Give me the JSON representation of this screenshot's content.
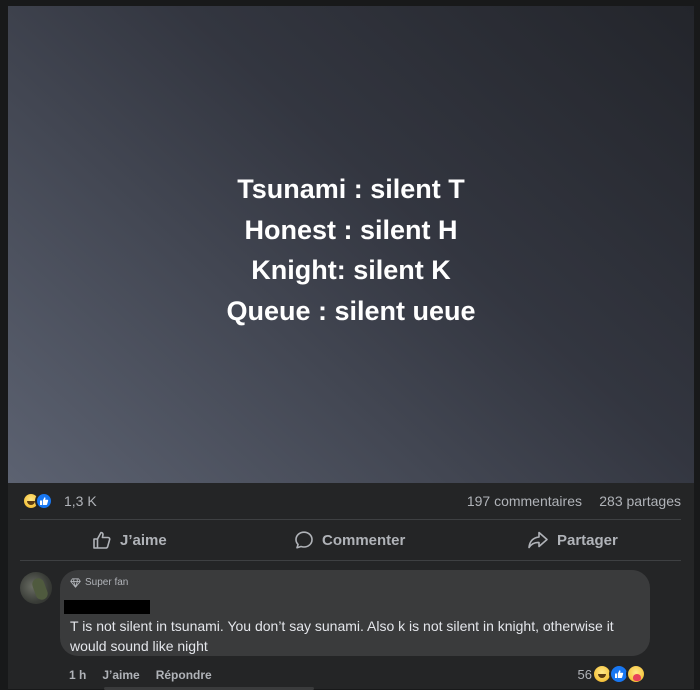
{
  "post": {
    "image_lines": [
      "Tsunami : silent T",
      "Honest : silent H",
      "Knight: silent K",
      "Queue : silent ueue"
    ],
    "reactions_icons": [
      "haha-icon",
      "like-icon"
    ],
    "reactions_count": "1,3 K",
    "comments_count": "197 commentaires",
    "shares_count": "283 partages"
  },
  "actions": {
    "like_label": "J’aime",
    "comment_label": "Commenter",
    "share_label": "Partager"
  },
  "comment": {
    "badge": "Super fan",
    "text": "T is not silent in tsunami. You don’t say sunami. Also k is not silent in knight, otherwise it would sound like night",
    "time": "1 h",
    "like_label": "J’aime",
    "reply_label": "Répondre",
    "reactions_count": "56",
    "reactions_icons": [
      "haha-icon",
      "like-icon",
      "care-icon"
    ]
  },
  "colors": {
    "background": "#18191a",
    "card": "#242526",
    "bubble": "#3a3b3c",
    "secondary_text": "#b0b3b8",
    "primary_text": "#e4e6eb",
    "like_blue": "#1877f2"
  }
}
